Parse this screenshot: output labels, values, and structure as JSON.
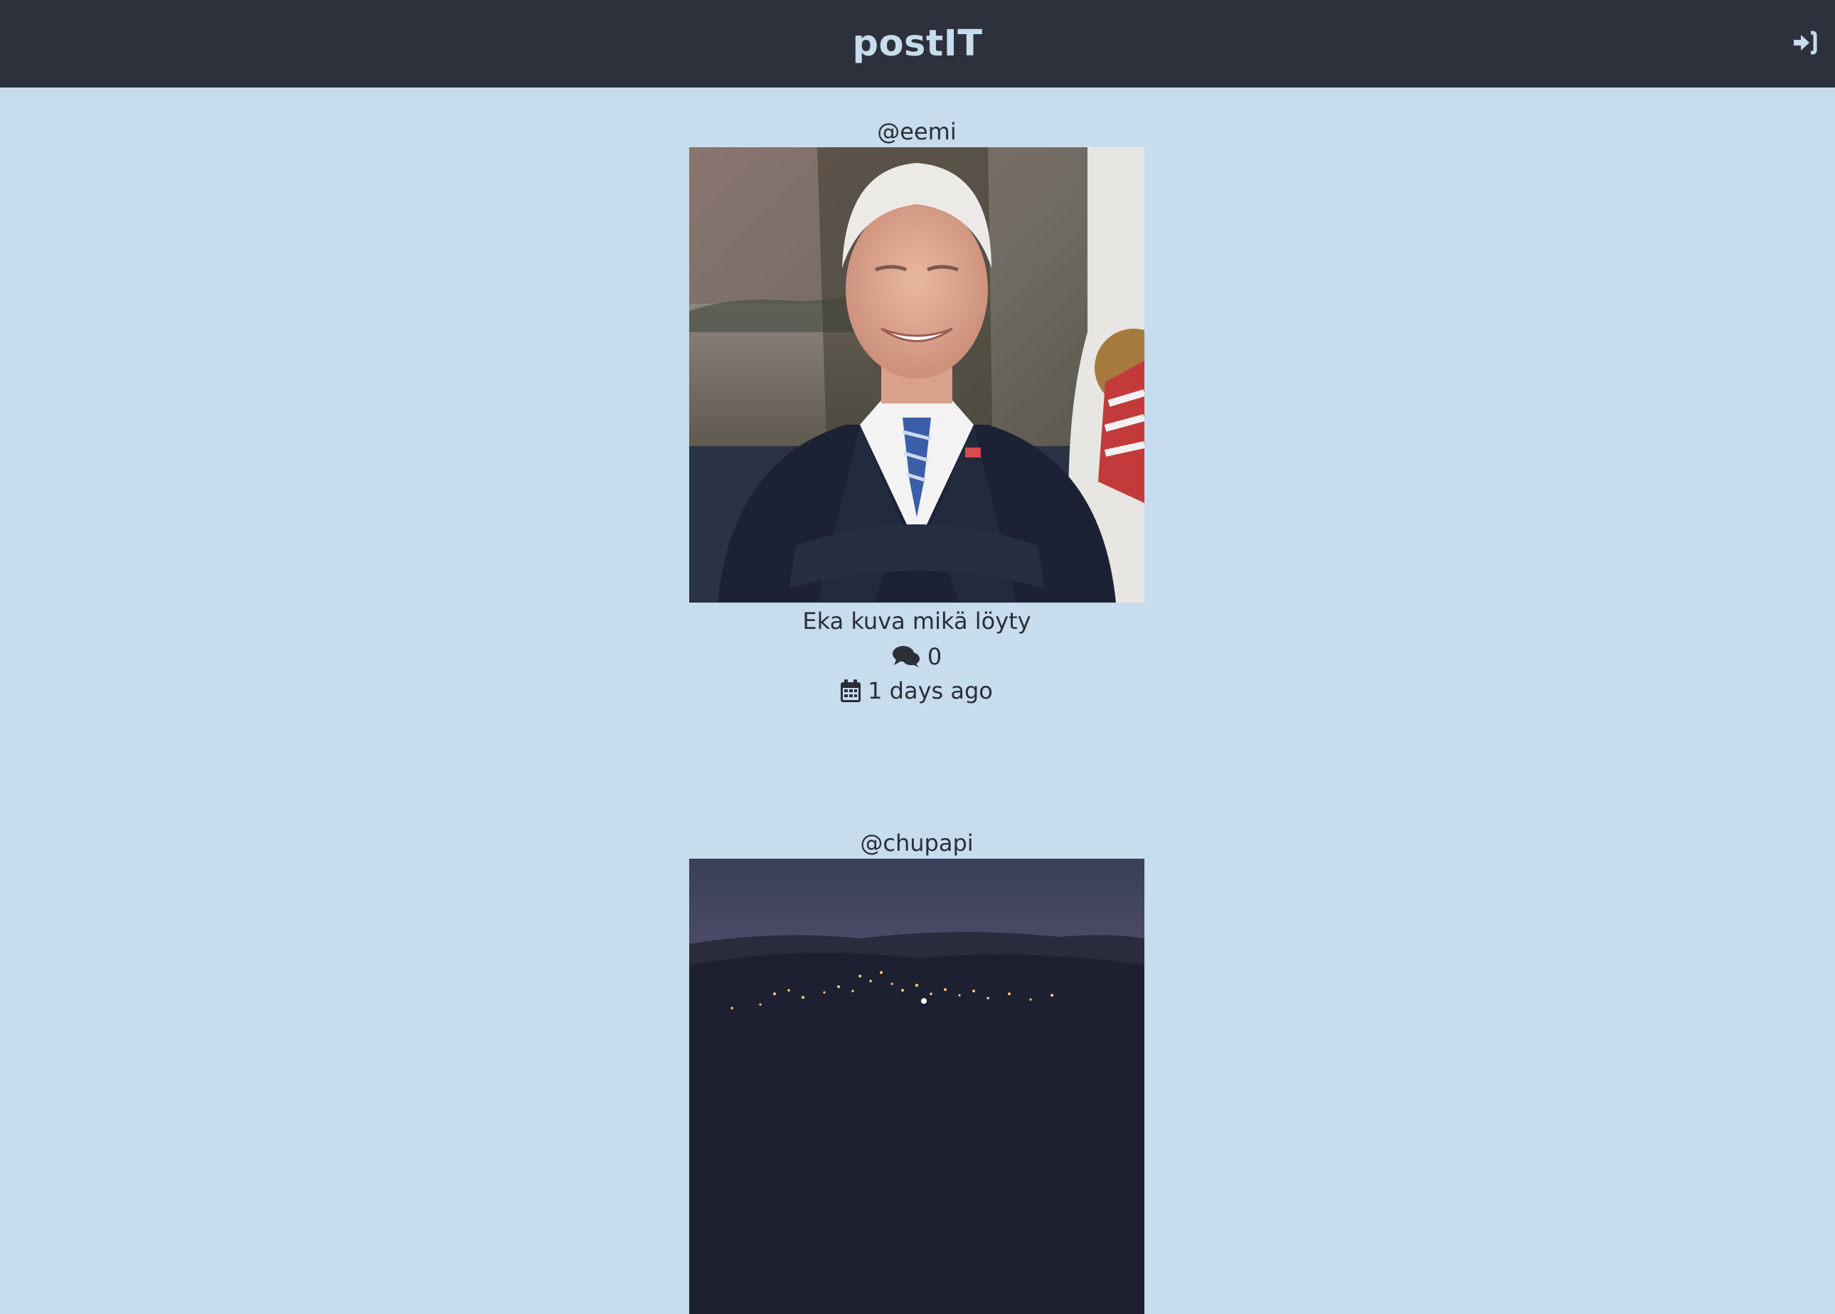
{
  "header": {
    "brand": "postIT",
    "login_icon": "sign-in-icon"
  },
  "posts": [
    {
      "username": "@eemi",
      "image": "portrait-photo",
      "caption": "Eka kuva mikä löyty",
      "comments_icon": "comments-icon",
      "comments_count": "0",
      "date_icon": "calendar-icon",
      "date_text": "1 days ago"
    },
    {
      "username": "@chupapi",
      "image": "city-night-photo"
    }
  ],
  "colors": {
    "navbar": "#2c313b",
    "background": "#c7dced",
    "brand_text": "#c7dced",
    "text": "#2a2f38"
  }
}
